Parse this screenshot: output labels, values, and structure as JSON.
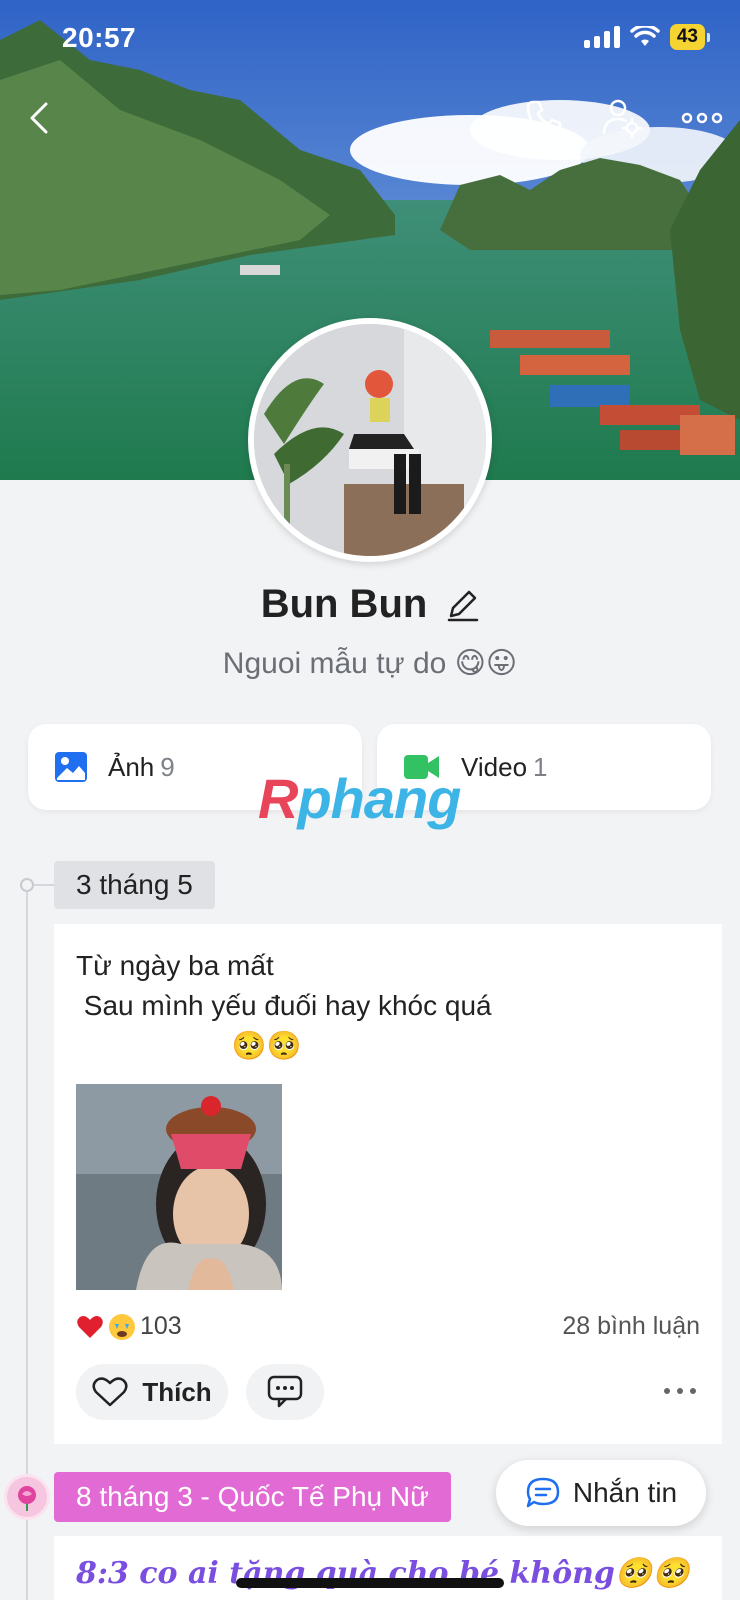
{
  "status_bar": {
    "time": "20:57",
    "battery": "43"
  },
  "profile": {
    "name": "Bun Bun",
    "bio": "Nguoi mẫu tự do 😋😛"
  },
  "media": {
    "photos_label": "Ảnh",
    "photos_count": "9",
    "videos_label": "Video",
    "videos_count": "1"
  },
  "watermark": {
    "part1": "R",
    "part2": "phang"
  },
  "timeline": {
    "post1": {
      "date": "3 tháng 5",
      "text": "Từ ngày ba mất\n Sau mình yếu đuối hay khóc quá\n                    🥺🥺",
      "reaction_count": "103",
      "comments": "28 bình luận",
      "like_label": "Thích"
    },
    "post2": {
      "date": "8 tháng 3 - Quốc Tế Phụ Nữ",
      "text": "8:3 co ai tặng quà cho bé không🥺🥺"
    }
  },
  "actions": {
    "message_label": "Nhắn tin"
  },
  "icons": {
    "back": "chevron-left-icon",
    "call": "phone-icon",
    "settings": "user-settings-icon",
    "more": "more-horizontal-icon",
    "edit": "pencil-icon",
    "photos": "image-icon",
    "videos": "video-camera-icon",
    "like": "heart-outline-icon",
    "comment": "comment-bubble-icon",
    "message": "chat-bubble-icon",
    "rose": "rose-icon"
  },
  "colors": {
    "accent_blue": "#1f6ff0",
    "video_green": "#33c263",
    "chip_pink": "#e26ad5",
    "post2_text": "#7a4fe0",
    "battery": "#f5d431"
  }
}
